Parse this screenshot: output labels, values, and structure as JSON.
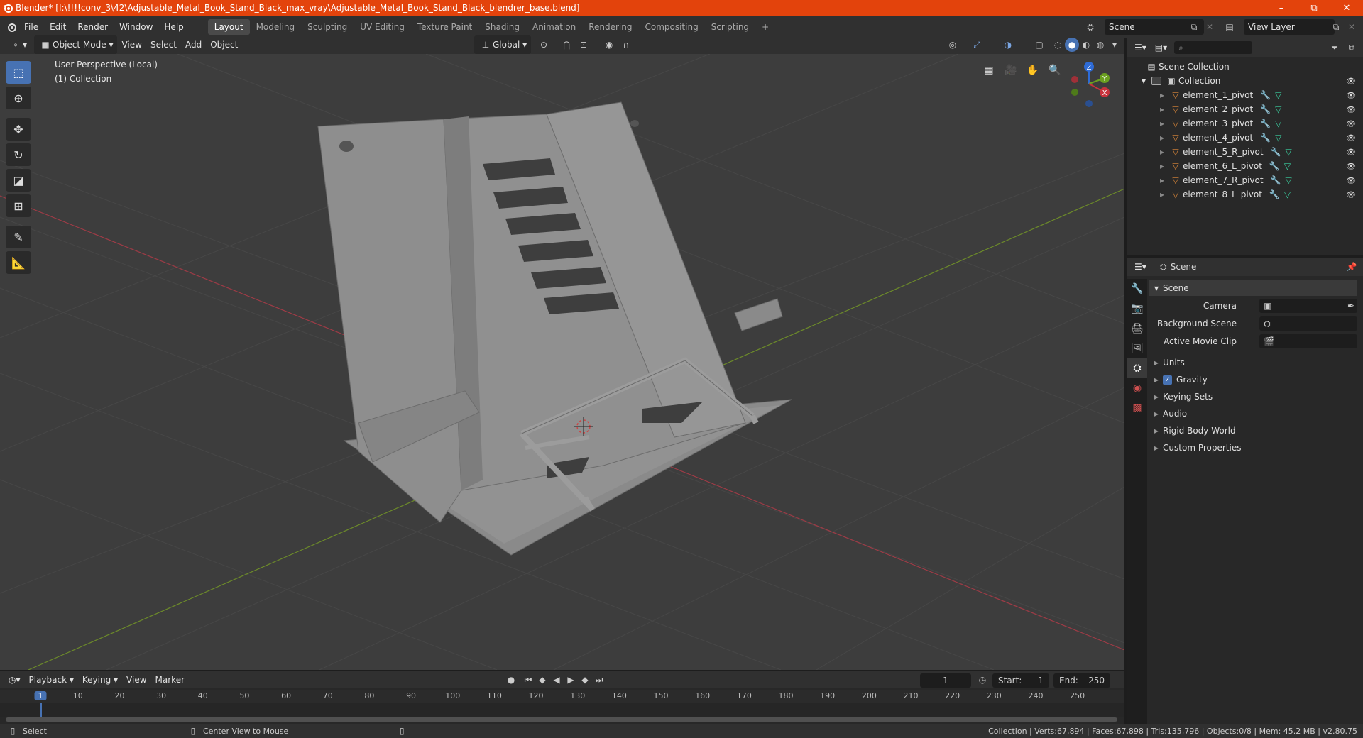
{
  "window": {
    "title": "Blender* [I:\\!!!!conv_3\\42\\Adjustable_Metal_Book_Stand_Black_max_vray\\Adjustable_Metal_Book_Stand_Black_blendrer_base.blend]",
    "minimize": "–",
    "maximize": "⧉",
    "close": "✕"
  },
  "menubar": {
    "items": [
      "File",
      "Edit",
      "Render",
      "Window",
      "Help"
    ],
    "workspaces": [
      "Layout",
      "Modeling",
      "Sculpting",
      "UV Editing",
      "Texture Paint",
      "Shading",
      "Animation",
      "Rendering",
      "Compositing",
      "Scripting"
    ],
    "active_workspace": "Layout",
    "add_workspace": "+",
    "scene": "Scene",
    "view_layer": "View Layer"
  },
  "viewport_header": {
    "mode": "Object Mode",
    "menus": [
      "View",
      "Select",
      "Add",
      "Object"
    ],
    "orientation": "Global"
  },
  "viewport": {
    "perspective": "User Perspective (Local)",
    "collection": "(1) Collection",
    "gizmo": {
      "z": "Z",
      "y": "Y",
      "x": "X"
    },
    "colors": {
      "background": "#3d3d3d",
      "grid": "#4a4a4a",
      "x_axis": "#9e3b46",
      "y_axis": "#6c8a2a",
      "model": "#8e8e8e"
    }
  },
  "outliner": {
    "root": "Scene Collection",
    "collection": "Collection",
    "items": [
      {
        "name": "element_1_pivot"
      },
      {
        "name": "element_2_pivot"
      },
      {
        "name": "element_3_pivot"
      },
      {
        "name": "element_4_pivot"
      },
      {
        "name": "element_5_R_pivot"
      },
      {
        "name": "element_6_L_pivot"
      },
      {
        "name": "element_7_R_pivot"
      },
      {
        "name": "element_8_L_pivot"
      }
    ]
  },
  "properties": {
    "context": "Scene",
    "panel_title": "Scene",
    "fields": {
      "camera": "Camera",
      "background_scene": "Background Scene",
      "active_movie_clip": "Active Movie Clip"
    },
    "sections": [
      "Units",
      "Gravity",
      "Keying Sets",
      "Audio",
      "Rigid Body World",
      "Custom Properties"
    ],
    "gravity_checked": true
  },
  "timeline": {
    "menus": [
      "Playback",
      "Keying",
      "View",
      "Marker"
    ],
    "current_frame": "1",
    "start_label": "Start:",
    "start": "1",
    "end_label": "End:",
    "end": "250",
    "ticks": [
      "1",
      "10",
      "20",
      "30",
      "40",
      "50",
      "60",
      "70",
      "80",
      "90",
      "100",
      "110",
      "120",
      "130",
      "140",
      "150",
      "160",
      "170",
      "180",
      "190",
      "200",
      "210",
      "220",
      "230",
      "240",
      "250"
    ]
  },
  "statusbar": {
    "select": "Select",
    "center_view": "Center View to Mouse",
    "stats": "Collection | Verts:67,894 | Faces:67,898 | Tris:135,796 | Objects:0/8 | Mem: 45.2 MB | v2.80.75"
  }
}
